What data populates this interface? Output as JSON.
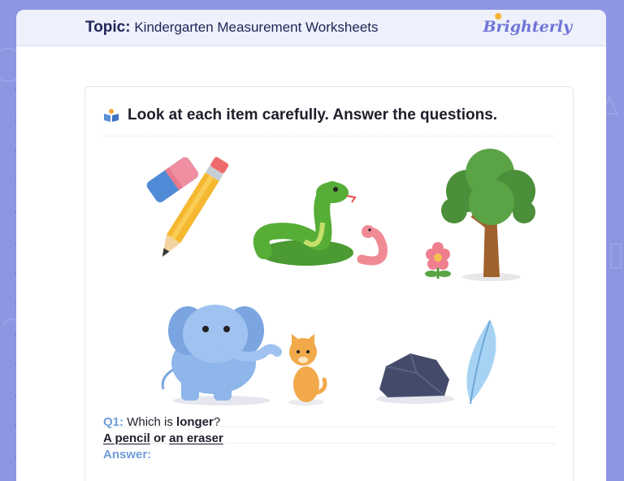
{
  "header": {
    "topic_label": "Topic:",
    "topic_title": "Kindergarten Measurement Worksheets",
    "logo_text": "Brighterly"
  },
  "card": {
    "instruction": "Look at each item carefully. Answer the questions."
  },
  "question1": {
    "label": "Q1:",
    "prompt_start": "Which is ",
    "prompt_keyword": "longer",
    "prompt_end": "?",
    "option_a": "A pencil",
    "connector": " or ",
    "option_b": "an eraser",
    "answer_label": "Answer:"
  },
  "illustrations": [
    "eraser",
    "pencil",
    "green-snake",
    "pink-worm",
    "tree",
    "flower",
    "elephant",
    "cat",
    "rock",
    "feather"
  ],
  "colors": {
    "accent": "#6f74d8",
    "label_blue": "#6f9cd9",
    "background": "#8e95e3"
  }
}
